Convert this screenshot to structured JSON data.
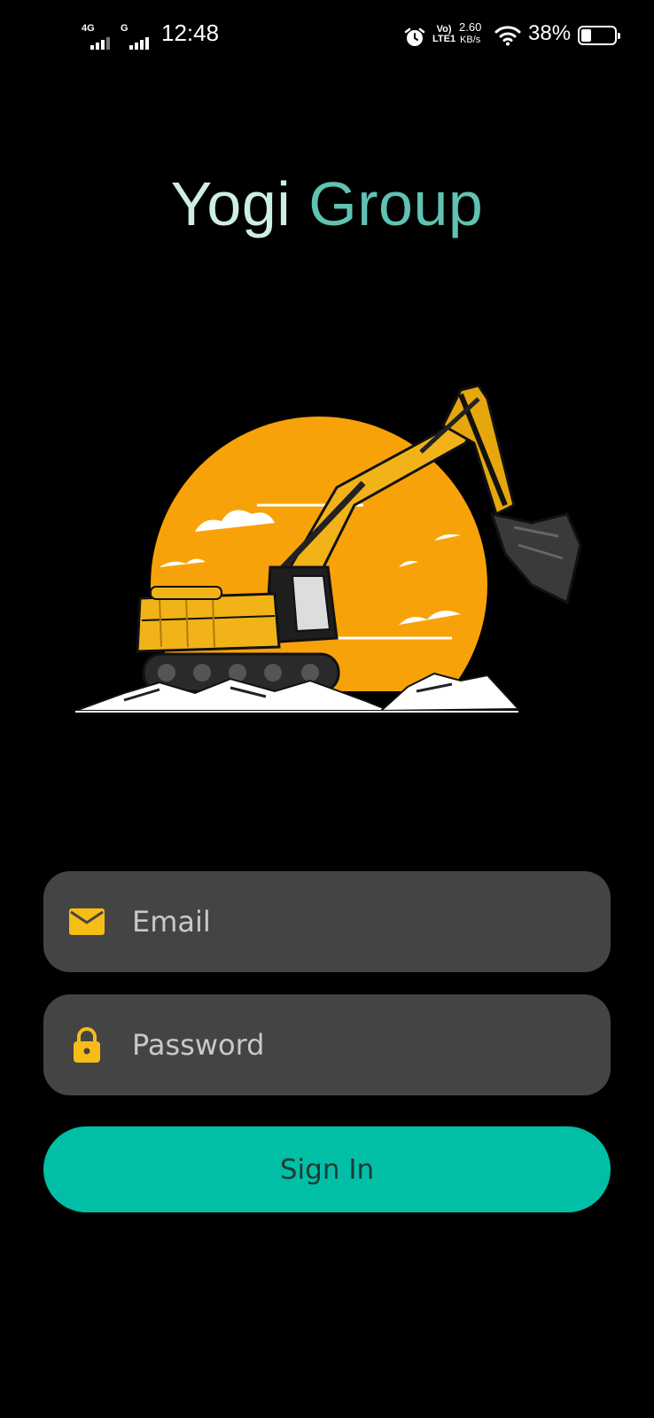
{
  "status_bar": {
    "network1": "4G",
    "network2": "G",
    "time": "12:48",
    "volte_line1": "Vo)",
    "volte_line2": "LTE1",
    "speed_value": "2.60",
    "speed_unit": "KB/s",
    "battery_percent": "38%",
    "battery_level": 0.38
  },
  "brand": {
    "word1": "Yogi",
    "word2": "Group",
    "color_word1": "#cdeee6",
    "color_word2": "#5fc2b3"
  },
  "hero": {
    "icon": "excavator-illustration"
  },
  "login": {
    "email_placeholder": "Email",
    "email_icon": "envelope-icon",
    "password_placeholder": "Password",
    "password_icon": "lock-icon",
    "signin_label": "Sign In",
    "accent": "#00bfa6",
    "icon_color": "#f6bd16"
  }
}
